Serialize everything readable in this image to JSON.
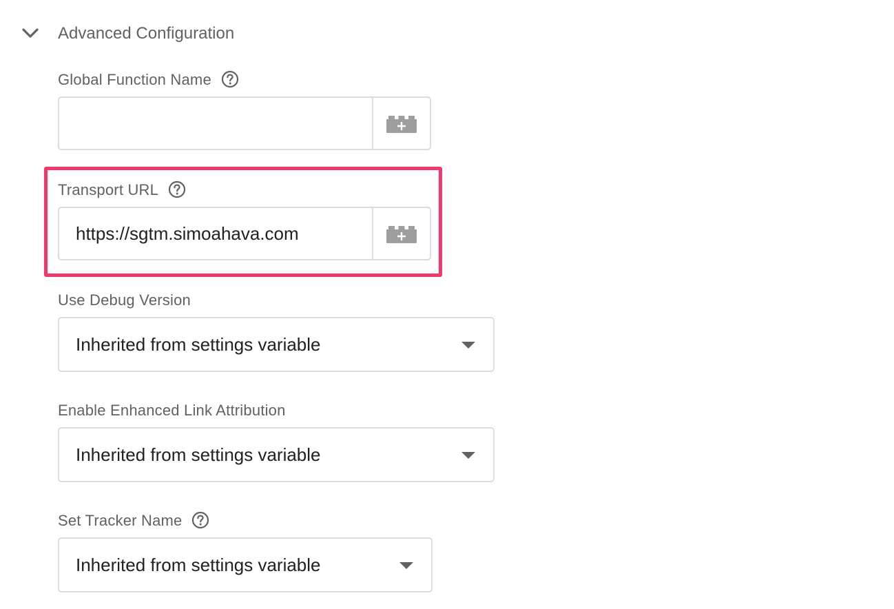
{
  "section": {
    "title": "Advanced Configuration",
    "chevron_icon": "chevron-down-icon"
  },
  "global_function_name": {
    "label": "Global Function Name",
    "value": "",
    "help_icon": "help-circle-icon",
    "variable_icon": "variable-brick-plus-icon"
  },
  "transport_url": {
    "label": "Transport URL",
    "value": "https://sgtm.simoahava.com",
    "help_icon": "help-circle-icon",
    "variable_icon": "variable-brick-plus-icon",
    "highlight_color": "#f0386b"
  },
  "use_debug_version": {
    "label": "Use Debug Version",
    "selected": "Inherited from settings variable"
  },
  "enhanced_link_attribution": {
    "label": "Enable Enhanced Link Attribution",
    "selected": "Inherited from settings variable"
  },
  "tracker_name": {
    "label": "Set Tracker Name",
    "selected": "Inherited from settings variable",
    "help_icon": "help-circle-icon"
  },
  "colors": {
    "label_text": "#616161",
    "value_text": "#212121",
    "border": "#dadce0",
    "highlight": "#f0386b"
  }
}
